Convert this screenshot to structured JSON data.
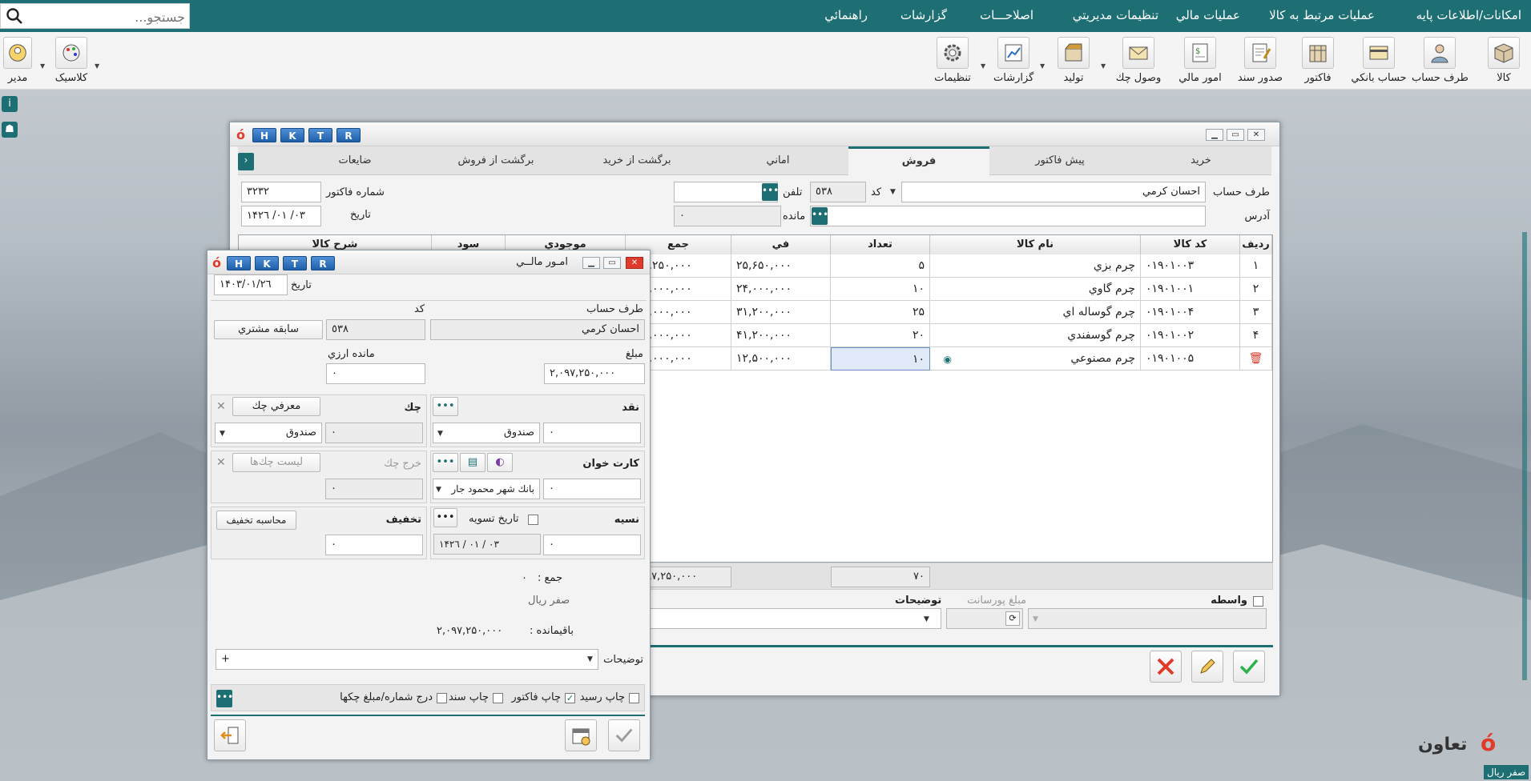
{
  "menu": {
    "items": [
      "امکانات/اطلاعات پایه",
      "عملیات مرتبط به کالا",
      "عملیات مالي",
      "تنظیمات مدیریتي",
      "اصلاحـــات",
      "گزارشات",
      "راهنمائي"
    ],
    "search_placeholder": "جستجو..."
  },
  "toolbar": {
    "buttons": [
      "کالا",
      "طرف حساب",
      "حساب بانکي",
      "فاکتور",
      "صدور سند",
      "امور مالي",
      "وصول چك",
      "تولید",
      "گزارشات",
      "تنظیمات"
    ],
    "user_label": "مدیر",
    "theme_label": "کلاسیک"
  },
  "invoice": {
    "htkr": [
      "H",
      "K",
      "T",
      "R"
    ],
    "tabs": [
      "خرید",
      "پیش فاکتور",
      "فروش",
      "اماني",
      "برگشت از خرید",
      "برگشت از فروش",
      "ضایعات"
    ],
    "labels": {
      "party": "طرف حساب",
      "code": "کد",
      "phone": "تلفن",
      "address": "آدرس",
      "balance": "مانده",
      "invoice_no": "شماره فاکتور",
      "date": "تاریخ"
    },
    "party_value": "احسان کرمي",
    "code_value": "٥٣٨",
    "invoice_no_value": "٣٢٣٢",
    "date_value": "١۴٠٣/ ٠١/ ٢٦",
    "balance_value": "٠",
    "columns": [
      "ردیف",
      "کد کالا",
      "نام کالا",
      "تعداد",
      "في",
      "جمع",
      "موجودي",
      "سود",
      "شرح کالا"
    ],
    "rows": [
      {
        "idx": "١",
        "code": "٠١٩٠١٠٠٣",
        "name": "چرم بزي",
        "qty": "۵",
        "fee": "٢۵,۶۵٠,٠٠٠",
        "total": "١٢٨,٢۵٠,٠٠٠"
      },
      {
        "idx": "٢",
        "code": "٠١٩٠١٠٠١",
        "name": "چرم گاوي",
        "qty": "١٠",
        "fee": "٢۴,٠٠٠,٠٠٠",
        "total": "٢۴٠,٠٠٠,٠٠٠"
      },
      {
        "idx": "٣",
        "code": "٠١٩٠١٠٠۴",
        "name": "چرم گوساله اي",
        "qty": "٢۵",
        "fee": "٣١,٢٠٠,٠٠٠",
        "total": "٧٨٠,٠٠٠,٠٠٠"
      },
      {
        "idx": "۴",
        "code": "٠١٩٠١٠٠٢",
        "name": "چرم گوسفندي",
        "qty": "٢٠",
        "fee": "۴١,٢٠٠,٠٠٠",
        "total": "٨٢۴,٠٠٠,٠٠٠"
      },
      {
        "idx": "",
        "code": "٠١٩٠١٠٠۵",
        "name": "چرم مصنوعي",
        "qty": "١٠",
        "fee": "١٢,۵٠٠,٠٠٠",
        "total": "١٢۵,٠٠٠,٠٠٠"
      }
    ],
    "total_qty": "٧٠",
    "total_amount": "٢,٠٩٧,٢۵٠,٠٠٠",
    "broker_label": "واسطه",
    "commission_label": "مبلغ پورسانت",
    "description_label": "توضیحات"
  },
  "finance": {
    "title": "امـور مالــي",
    "htkr": [
      "H",
      "K",
      "T",
      "R"
    ],
    "date_label": "تاریخ",
    "date_value": "١۴٠٣/٠١/٢٦",
    "party_label": "طرف حساب",
    "party_value": "احسان کرمي",
    "code_label": "کد",
    "code_value": "٥٣٨",
    "history_button": "سابقه مشتري",
    "amount_label": "مبلغ",
    "amount_value": "٢,٠٩٧,٢۵٠,٠٠٠",
    "fx_balance_label": "مانده ارزي",
    "fx_balance_value": "٠",
    "cash_label": "نقد",
    "cash_box": "صندوق",
    "cash_value": "٠",
    "check_label": "چك",
    "intro_check": "معرفي چك",
    "check_box": "صندوق",
    "check_value": "٠",
    "card_label": "کارت خوان",
    "card_bank": "بانك شهر محمود جار",
    "card_value": "٠",
    "spend_check_label": "خرج چك",
    "check_list": "لیست چك‌ها",
    "spend_check_value": "٠",
    "credit_label": "نسیه",
    "settle_date_label": "تاریخ تسویه",
    "settle_date_value": "١۴٠٣ / ٠١ / ٢٦",
    "credit_value": "٠",
    "discount_label": "تخفیف",
    "calc_discount": "محاسبه تخفیف",
    "discount_value": "٠",
    "sum_label": "جمع :",
    "sum_value": "٠",
    "sum_words": "صفر ریال",
    "remain_label": "باقیمانده :",
    "remain_value": "٢,٠٩٧,٢۵٠,٠٠٠",
    "desc_label": "توضیحات",
    "desc_plus": "+",
    "print_receipt": "چاپ رسید",
    "print_invoice": "چاپ فاکتور",
    "print_doc": "چاپ سند",
    "insert_check": "درج شماره/مبلغ چکها"
  },
  "footer": {
    "brand": "تعاون",
    "status": "صفر ریال"
  },
  "colors": {
    "accent": "#1d6f74",
    "htkr": "#2a6fbf",
    "danger": "#e03a2b",
    "ok": "#2bb24c"
  }
}
